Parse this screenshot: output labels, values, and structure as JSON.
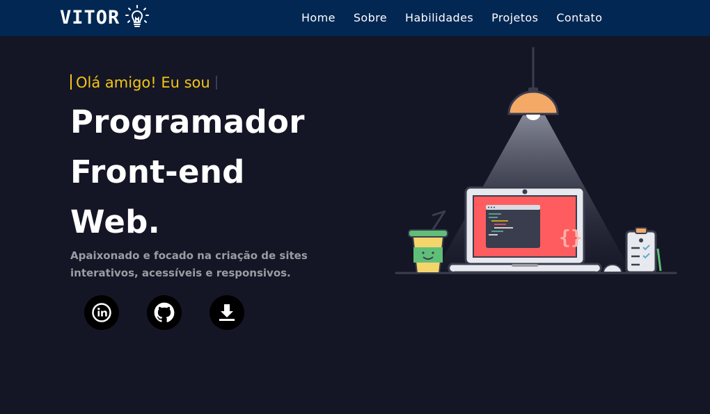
{
  "brand": {
    "name": "VITOR",
    "logo_icon": "lightbulb-icon"
  },
  "nav": {
    "items": [
      {
        "label": "Home"
      },
      {
        "label": "Sobre"
      },
      {
        "label": "Habilidades"
      },
      {
        "label": "Projetos"
      },
      {
        "label": "Contato"
      }
    ]
  },
  "hero": {
    "intro": "Olá amigo! Eu sou",
    "title_lines": [
      "Programador",
      "Front-end",
      "Web."
    ],
    "description": "Apaixonado e focado na criação de sites interativos, acessíveis e responsivos."
  },
  "socials": [
    {
      "icon": "linkedin-icon"
    },
    {
      "icon": "github-icon"
    },
    {
      "icon": "download-icon"
    }
  ],
  "colors": {
    "background": "#141625",
    "header": "#032753",
    "accent": "#f5c518",
    "muted_text": "#9c9ca4",
    "screen": "#fe5c5e",
    "lamp": "#f4a966"
  }
}
